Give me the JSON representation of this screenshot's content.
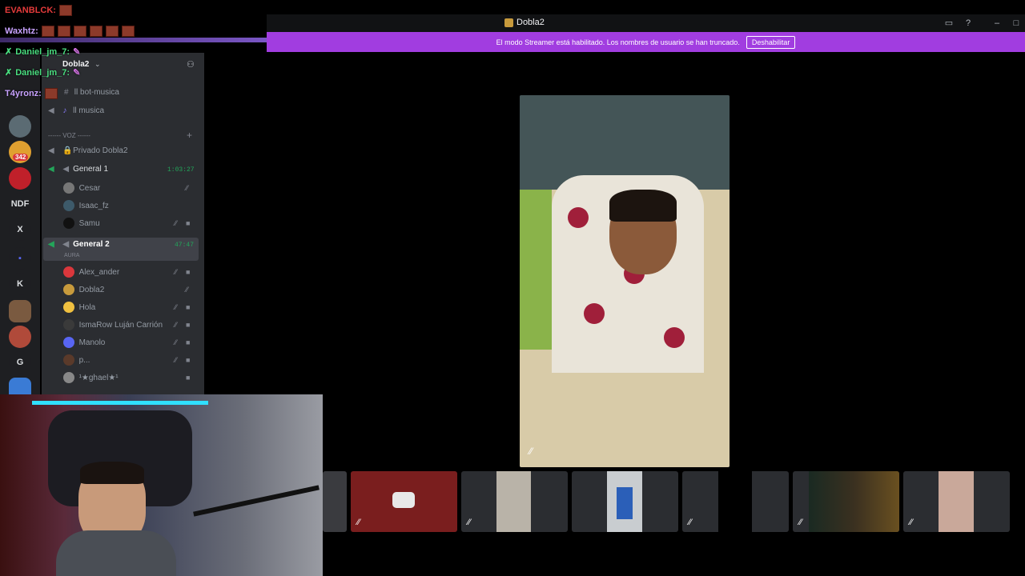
{
  "window": {
    "title": "Dobla2"
  },
  "banner": {
    "text": "El modo Streamer está habilitado. Los nombres de usuario se han truncado.",
    "button": "Deshabilitar"
  },
  "chat": [
    {
      "user": "EVANBLCK:",
      "color": "#e53b3b"
    },
    {
      "user": "Waxhtz:",
      "color": "#c8a2ff"
    },
    {
      "user": "Daniel_jm_7:",
      "color": "#4ade80"
    },
    {
      "user": "Daniel_jm_7:",
      "color": "#4ade80"
    },
    {
      "user": "T4yronz:",
      "color": "#c8a2ff"
    }
  ],
  "server": {
    "name": "Dobla2"
  },
  "rail": {
    "badge": "342",
    "items": [
      "NDF",
      "X",
      "K",
      "G"
    ]
  },
  "channels": {
    "text": [
      "ll bot-musica",
      "ll musica"
    ],
    "voice_header": "------ VOZ ------",
    "private": "Privado Dobla2",
    "general1": {
      "name": "General 1",
      "time": "1:03:27",
      "users": [
        "Cesar",
        "Isaac_fz",
        "Samu"
      ]
    },
    "general2": {
      "name": "General 2",
      "time": "47:47",
      "sub": "AURA",
      "users": [
        "Alex_ander",
        "Dobla2",
        "Hola",
        "IsmaRow Luján Carrión",
        "Manolo",
        "p...",
        "¹★ghael★¹"
      ]
    }
  },
  "colors": {
    "accent": "#a13de0",
    "voice_active": "#23a55a"
  }
}
